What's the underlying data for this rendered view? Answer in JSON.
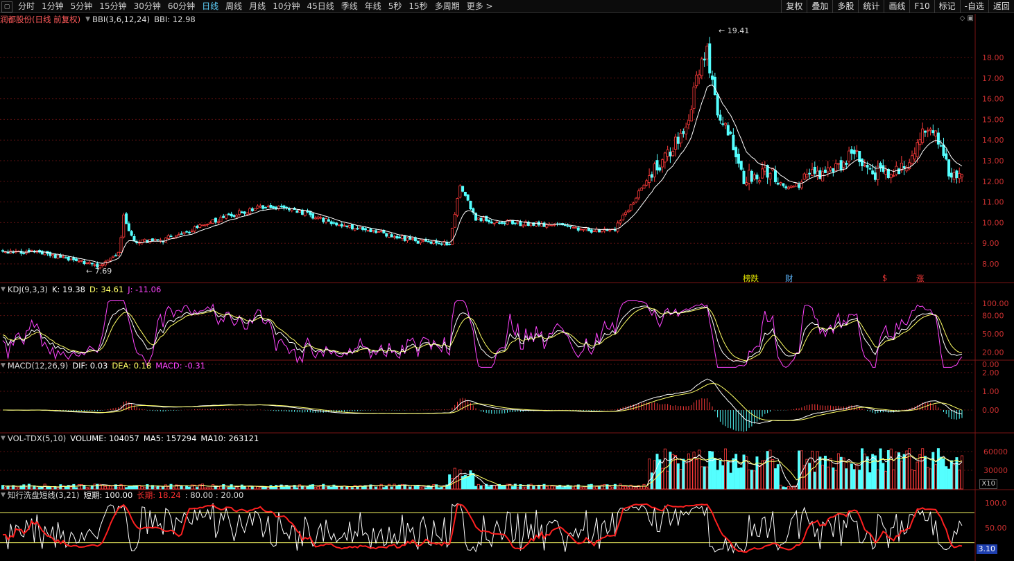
{
  "toolbar": {
    "toggle_icon": "square-toggle-icon",
    "periods": [
      "分时",
      "1分钟",
      "5分钟",
      "15分钟",
      "30分钟",
      "60分钟",
      "日线",
      "周线",
      "月线",
      "10分钟",
      "45日线",
      "季线",
      "年线",
      "5秒",
      "15秒",
      "多周期",
      "更多 >"
    ],
    "active_period": "日线",
    "right_buttons": [
      "复权",
      "叠加",
      "多股",
      "统计",
      "画线",
      "F10",
      "标记",
      "-自选",
      "返回"
    ]
  },
  "main_panel": {
    "stock_name": "润都股份(日线 前复权)",
    "indicator": "BBI(3,6,12,24)",
    "indicator_value": "BBI: 12.98",
    "high_label": "19.41",
    "low_label": "7.69",
    "axis_ticks": [
      "18.00",
      "17.00",
      "16.00",
      "15.00",
      "14.00",
      "13.00",
      "12.00",
      "11.00",
      "10.00",
      "9.00",
      "8.00"
    ],
    "markers": [
      {
        "text": "榜跌",
        "color": "#e6e600"
      },
      {
        "text": "财",
        "color": "#5fb8ff"
      },
      {
        "text": "$",
        "color": "#ff3b3b"
      },
      {
        "text": "涨",
        "color": "#ff3b3b"
      }
    ]
  },
  "kdj_panel": {
    "name": "KDJ(9,3,3)",
    "k": "K: 19.38",
    "d": "D: 34.61",
    "j": "J: -11.06",
    "axis_ticks": [
      "100.00",
      "80.00",
      "50.00",
      "20.00",
      "0.00"
    ]
  },
  "macd_panel": {
    "name": "MACD(12,26,9)",
    "dif": "DIF: 0.03",
    "dea": "DEA: 0.18",
    "macd": "MACD: -0.31",
    "axis_ticks": [
      "2.00",
      "1.00",
      "0.00"
    ]
  },
  "vol_panel": {
    "name": "VOL-TDX(5,10)",
    "volume": "VOLUME: 104057",
    "ma5": "MA5: 157294",
    "ma10": "MA10: 263121",
    "axis_ticks": [
      "60000",
      "30000"
    ],
    "scale_label": "X10"
  },
  "wash_panel": {
    "name": "知行洗盘短线(3,21)",
    "short_label": "短期: 100.00",
    "long_label": "长期: 18.24",
    "levels": ": 80.00 : 20.00",
    "axis_ticks": [
      "100.0",
      "50.00"
    ],
    "current_value": "3.10"
  },
  "colors": {
    "up": "#ff3b3b",
    "down": "#54ffff",
    "kdj_k": "#ffffff",
    "kdj_d": "#ffff66",
    "kdj_j": "#ff44ff",
    "wash_long": "#ff2020",
    "wash_short": "#ffffff",
    "level_line": "#ffff66"
  }
}
